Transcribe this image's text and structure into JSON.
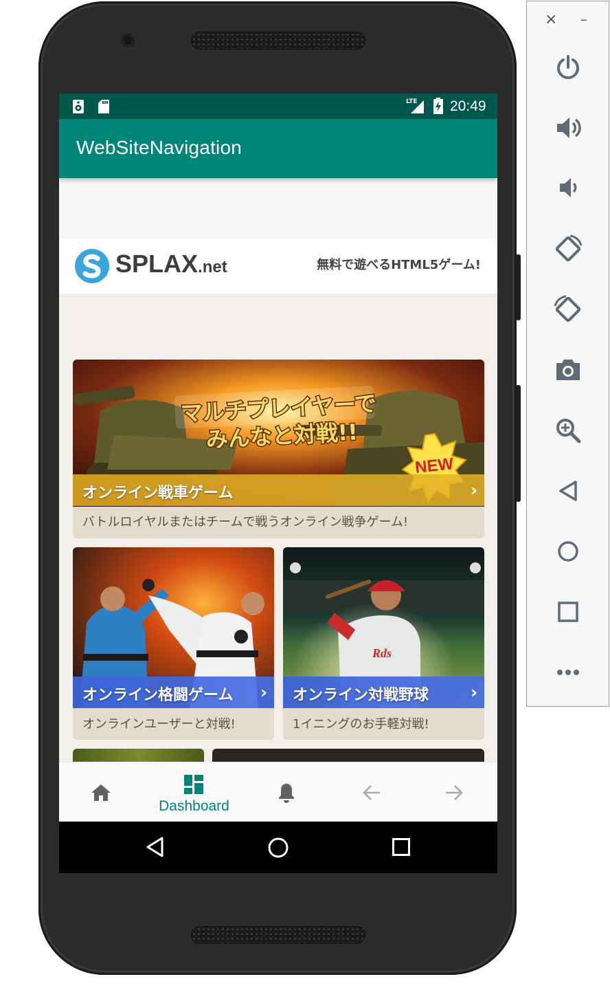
{
  "status_bar": {
    "network": "LTE",
    "time": "20:49"
  },
  "app_bar": {
    "title": "WebSiteNavigation"
  },
  "site": {
    "logo_text": "SPLAX",
    "logo_suffix": ".net",
    "tagline": "無料で遊べるHTML5ゲーム!",
    "cards": [
      {
        "title": "オンライン戦車ゲーム",
        "banner_line1": "マルチプレイヤーで",
        "banner_line2": "みんなと対戦!!",
        "badge": "NEW",
        "description": "バトルロイヤルまたはチームで戦うオンライン戦争ゲーム!",
        "bar_color": "#d6a020"
      },
      {
        "title": "オンライン格闘ゲーム",
        "description": "オンラインユーザーと対戦!",
        "bar_color": "#3b62d6"
      },
      {
        "title": "オンライン対戦野球",
        "uniform_text": "Rds",
        "description": "1イニングのお手軽対戦!",
        "bar_color": "#3b62d6"
      }
    ]
  },
  "bottom_nav": {
    "items": [
      {
        "icon": "home-icon",
        "label": ""
      },
      {
        "icon": "dashboard-icon",
        "label": "Dashboard",
        "active": true
      },
      {
        "icon": "bell-icon",
        "label": ""
      },
      {
        "icon": "arrow-back-icon",
        "label": ""
      },
      {
        "icon": "arrow-forward-icon",
        "label": ""
      }
    ],
    "active_color": "#008577"
  },
  "colors": {
    "primary": "#008577",
    "primary_dark": "#00574b"
  },
  "emulator_toolbar": {
    "close_label": "×",
    "minimize_label": "–",
    "buttons": [
      "power-icon",
      "volume-up-icon",
      "volume-down-icon",
      "rotate-left-icon",
      "rotate-right-icon",
      "camera-icon",
      "zoom-icon",
      "back-icon",
      "home-icon",
      "overview-icon",
      "more-icon"
    ]
  }
}
